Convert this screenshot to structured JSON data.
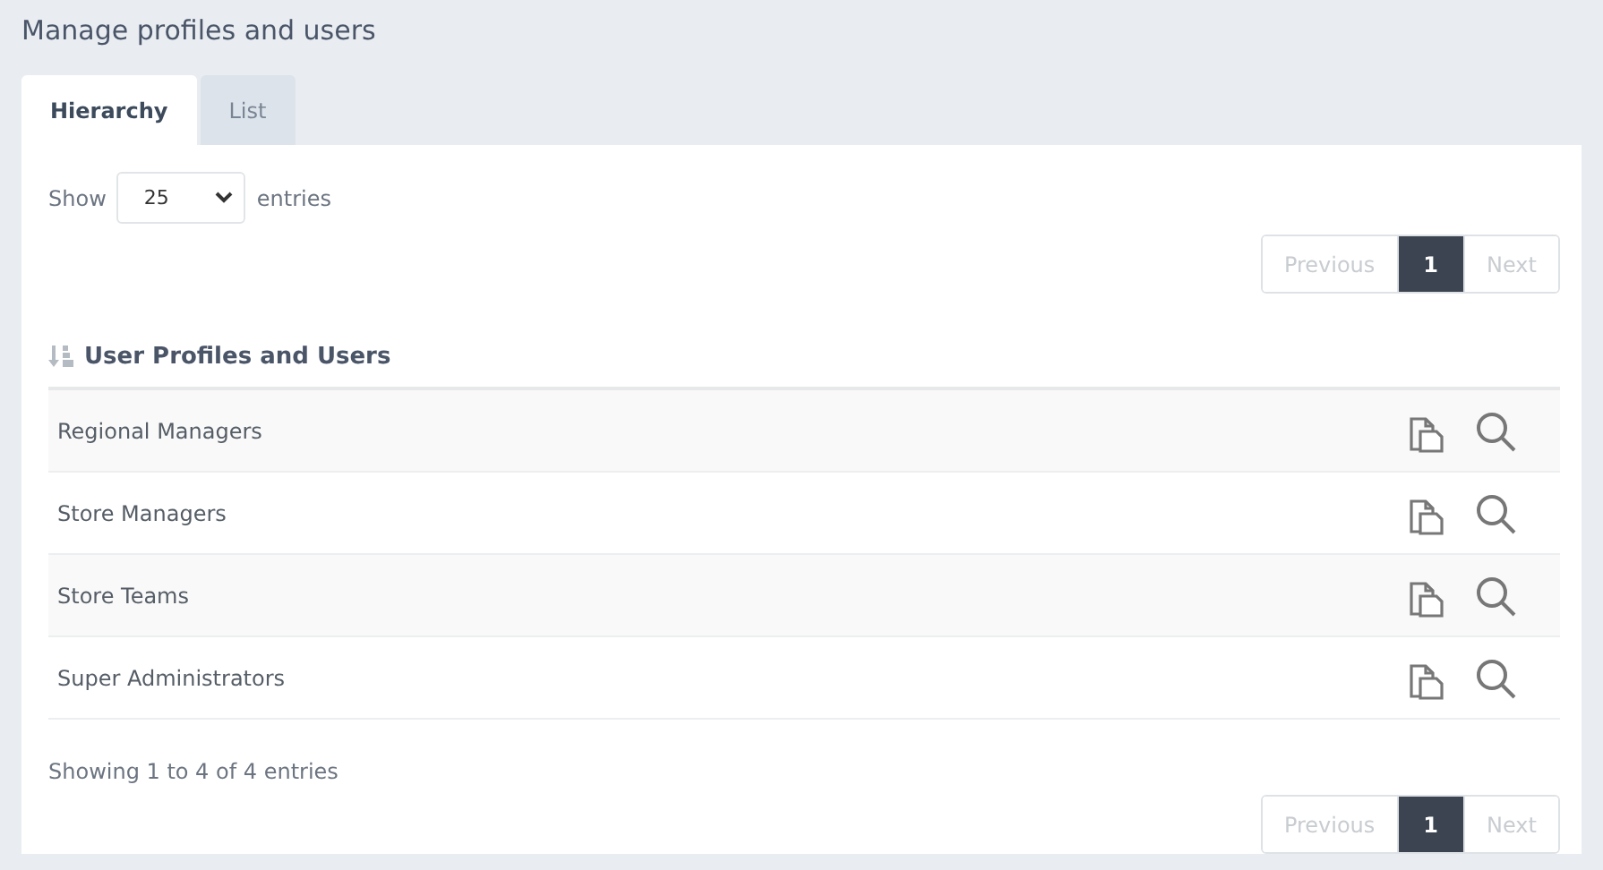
{
  "page_title": "Manage profiles and users",
  "tabs": [
    {
      "label": "Hierarchy",
      "selected": true
    },
    {
      "label": "List",
      "selected": false
    }
  ],
  "length_menu": {
    "before": "Show",
    "value": "25",
    "after": "entries"
  },
  "pagination_top": [
    {
      "label": "Previous",
      "selected": false,
      "disabled": true
    },
    {
      "label": "1",
      "selected": true,
      "disabled": false
    },
    {
      "label": "Next",
      "selected": false,
      "disabled": true
    }
  ],
  "table": {
    "heading": "User Profiles and Users",
    "rows": [
      {
        "name": "Regional Managers"
      },
      {
        "name": "Store Managers"
      },
      {
        "name": "Store Teams"
      },
      {
        "name": "Super Administrators"
      }
    ]
  },
  "info": "Showing 1 to 4 of 4 entries",
  "pagination_bottom": [
    {
      "label": "Previous",
      "selected": false,
      "disabled": true
    },
    {
      "label": "1",
      "selected": true,
      "disabled": false
    },
    {
      "label": "Next",
      "selected": false,
      "disabled": true
    }
  ]
}
